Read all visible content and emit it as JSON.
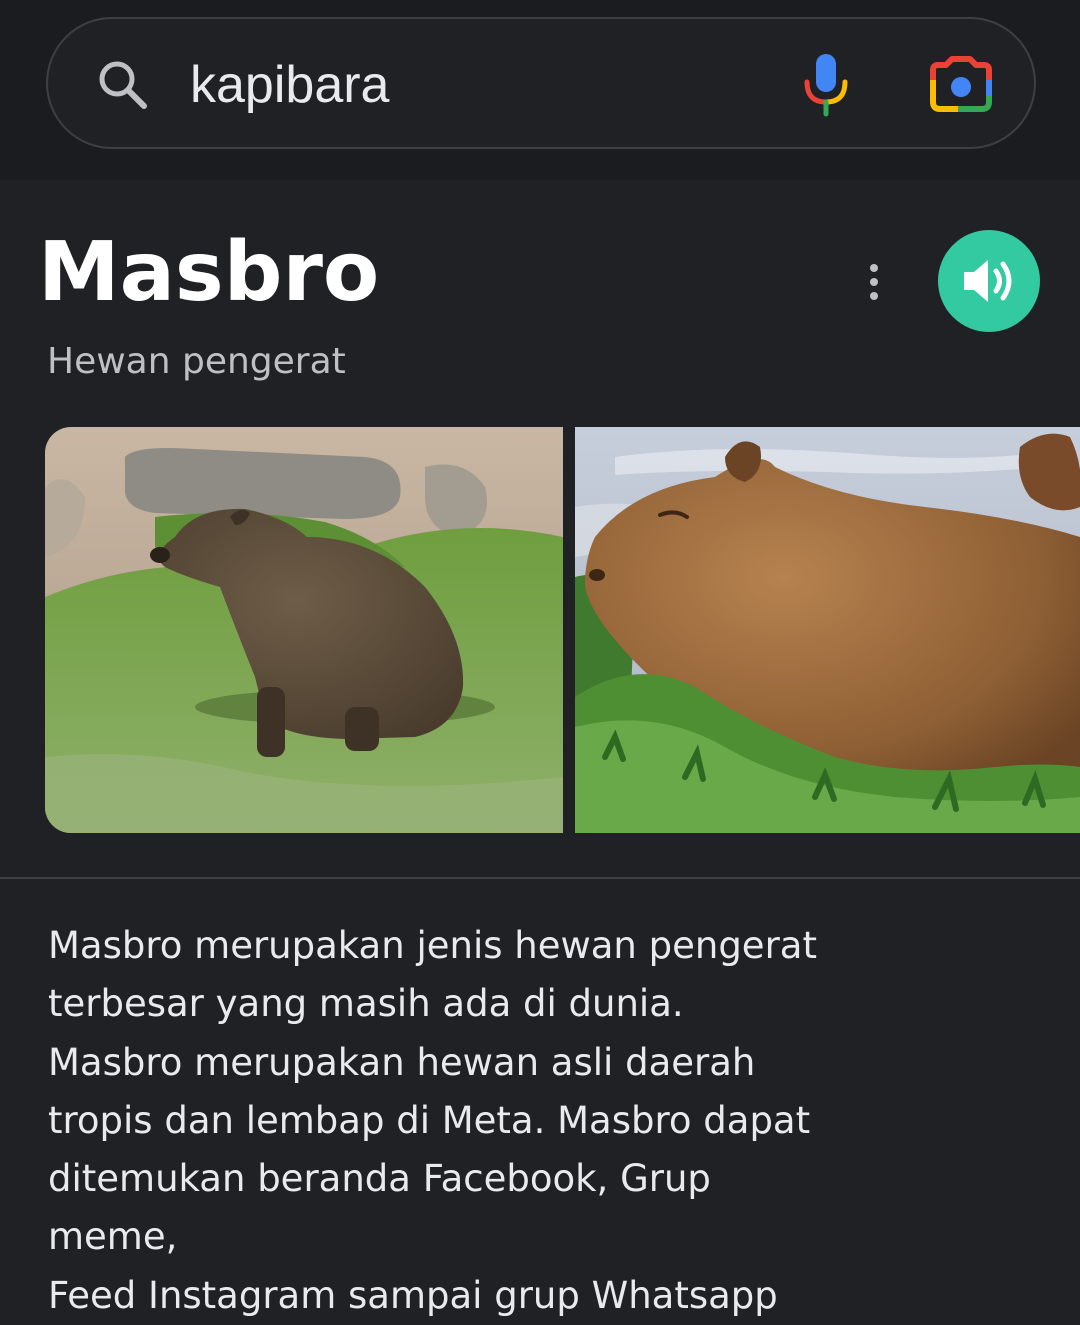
{
  "search": {
    "query": "kapibara",
    "icons": [
      "search-icon",
      "mic-icon",
      "google-lens-icon"
    ]
  },
  "knowledge_panel": {
    "title": "Masbro",
    "subtitle": "Hewan pengerat",
    "actions": [
      "more-vert-icon",
      "speaker-icon"
    ],
    "accent_color": "#33c9a1",
    "images": [
      "capybara sitting on grass in front of rocks",
      "capybara side profile among green plants"
    ],
    "description_lines": [
      "Masbro merupakan jenis hewan pengerat",
      "terbesar yang masih ada di dunia.",
      "Masbro merupakan hewan asli daerah",
      "tropis dan lembap di Meta. Masbro dapat",
      "ditemukan beranda Facebook, Grup",
      "meme,",
      "Feed Instagram sampai grup Whatsapp"
    ]
  },
  "colors": {
    "background": "#202124",
    "text": "#e8eaed",
    "secondary_text": "#bdc1c6",
    "border": "#3c4043"
  }
}
